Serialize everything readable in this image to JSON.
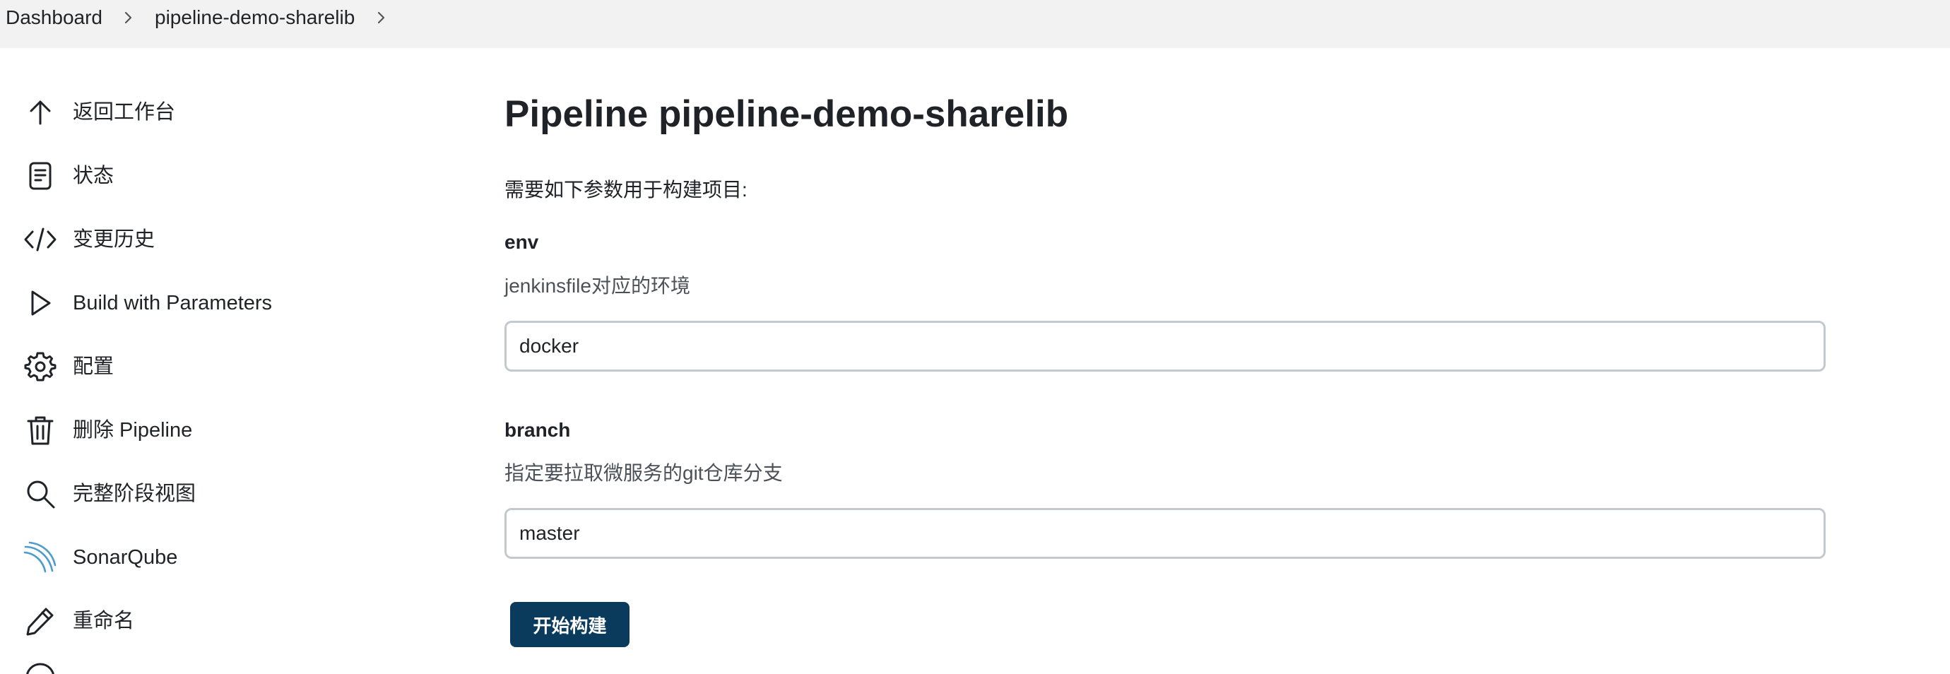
{
  "breadcrumb": {
    "items": [
      "Dashboard",
      "pipeline-demo-sharelib"
    ]
  },
  "sidebar": {
    "items": [
      {
        "label": "返回工作台",
        "icon": "arrow-up-icon"
      },
      {
        "label": "状态",
        "icon": "document-icon"
      },
      {
        "label": "变更历史",
        "icon": "code-icon"
      },
      {
        "label": "Build with Parameters",
        "icon": "play-icon"
      },
      {
        "label": "配置",
        "icon": "gear-icon"
      },
      {
        "label": "删除 Pipeline",
        "icon": "trash-icon"
      },
      {
        "label": "完整阶段视图",
        "icon": "search-icon"
      },
      {
        "label": "SonarQube",
        "icon": "sonarqube-icon"
      },
      {
        "label": "重命名",
        "icon": "pencil-icon"
      }
    ]
  },
  "main": {
    "title": "Pipeline pipeline-demo-sharelib",
    "intro": "需要如下参数用于构建项目:",
    "params": [
      {
        "name": "env",
        "description": "jenkinsfile对应的环境",
        "value": "docker"
      },
      {
        "name": "branch",
        "description": "指定要拉取微服务的git仓库分支",
        "value": "master"
      }
    ],
    "build_button": "开始构建"
  },
  "colors": {
    "accent": "#0b3b5c",
    "breadcrumb_bg": "#f2f2f2",
    "input_border": "#c2cad0",
    "sonarqube_blue": "#4e9bcd"
  }
}
